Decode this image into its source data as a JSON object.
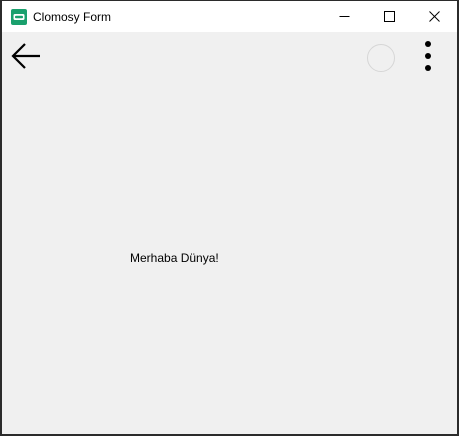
{
  "window": {
    "title": "Clomosy Form",
    "icon": "clomosy-app-icon",
    "controls": {
      "minimize_icon": "minimize-icon",
      "maximize_icon": "maximize-icon",
      "close_icon": "close-icon"
    }
  },
  "toolbar": {
    "back_icon": "arrow-left-icon",
    "loading_icon": "loading-circle-icon",
    "more_icon": "more-vertical-icon"
  },
  "content": {
    "greeting": "Merhaba Dünya!"
  },
  "colors": {
    "titlebar_bg": "#ffffff",
    "form_bg": "#f0f0f0",
    "icon_brand": "#1aa06d",
    "text": "#000000"
  }
}
